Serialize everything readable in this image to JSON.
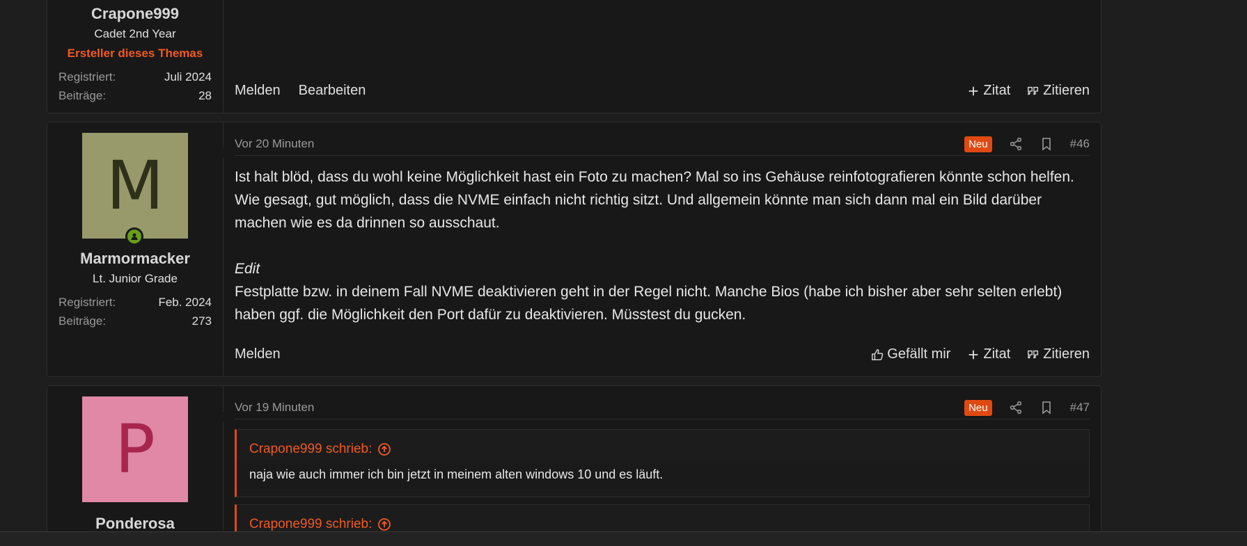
{
  "posts": [
    {
      "user": {
        "name": "Crapone999",
        "title": "Cadet 2nd Year",
        "op_badge": "Ersteller dieses Themas",
        "registered_label": "Registriert:",
        "registered_value": "Juli 2024",
        "posts_label": "Beiträge:",
        "posts_value": "28"
      },
      "actions": {
        "report": "Melden",
        "edit": "Bearbeiten",
        "quote_add": "Zitat",
        "quote": "Zitieren"
      }
    },
    {
      "user": {
        "avatar_letter": "M",
        "name": "Marmormacker",
        "title": "Lt. Junior Grade",
        "registered_label": "Registriert:",
        "registered_value": "Feb. 2024",
        "posts_label": "Beiträge:",
        "posts_value": "273"
      },
      "time": "Vor 20 Minuten",
      "new_badge": "Neu",
      "number": "#46",
      "body": {
        "p1": "Ist halt blöd, dass du wohl keine Möglichkeit hast ein Foto zu machen? Mal so ins Gehäuse reinfotografieren könnte schon helfen. Wie gesagt, gut möglich, dass die NVME einfach nicht richtig sitzt. Und allgemein könnte man sich dann mal ein Bild darüber machen wie es da drinnen so ausschaut.",
        "edit_label": "Edit",
        "p2": "Festplatte bzw. in deinem Fall NVME deaktivieren geht in der Regel nicht. Manche Bios (habe ich bisher aber sehr selten erlebt) haben ggf. die Möglichkeit den Port dafür zu deaktivieren. Müsstest du gucken."
      },
      "actions": {
        "report": "Melden",
        "like": "Gefällt mir",
        "quote_add": "Zitat",
        "quote": "Zitieren"
      }
    },
    {
      "user": {
        "avatar_letter": "P",
        "name": "Ponderosa"
      },
      "time": "Vor 19 Minuten",
      "new_badge": "Neu",
      "number": "#47",
      "quotes": [
        {
          "author": "Crapone999 schrieb:",
          "text": "naja wie auch immer ich bin jetzt in meinem alten windows 10 und es läuft."
        },
        {
          "author": "Crapone999 schrieb:"
        }
      ]
    }
  ],
  "colors": {
    "accent": "#e04a12",
    "background": "#1e1e1e",
    "panel": "#181818",
    "online": "#6a9e1a"
  }
}
